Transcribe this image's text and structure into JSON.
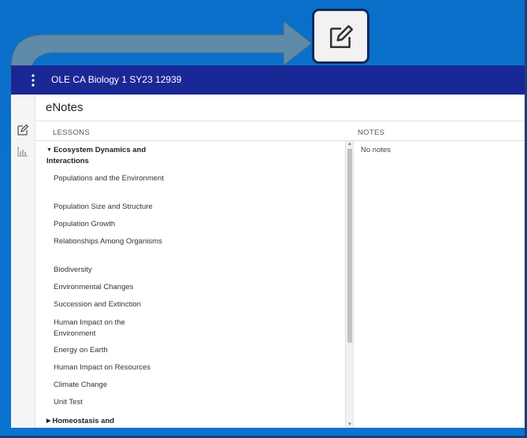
{
  "app": {
    "course_title": "OLE CA Biology 1 SY23 12939",
    "page_title": "eNotes"
  },
  "columns": {
    "lessons": "LESSONS",
    "notes": "NOTES"
  },
  "notes": {
    "empty_text": "No notes"
  },
  "units": [
    {
      "label": "Ecosystem Dynamics and Interactions",
      "expanded": true,
      "lessons": [
        "Populations and the Environment",
        "Population Size and Structure",
        "Population Growth",
        "Relationships Among Organisms",
        "Biodiversity",
        "Environmental Changes",
        "Succession and Extinction",
        "Human Impact on the Environment",
        "Energy on Earth",
        "Human Impact on Resources",
        "Climate Change",
        "Unit Test"
      ]
    },
    {
      "label": "Homeostasis and",
      "expanded": false,
      "lessons": []
    }
  ],
  "icons": {
    "rail": [
      "edit-icon",
      "bar-chart-icon"
    ],
    "callout": "edit-icon"
  },
  "colors": {
    "background": "#0a6fc9",
    "topbar": "#1a2896",
    "arrow": "#5a86a6"
  }
}
